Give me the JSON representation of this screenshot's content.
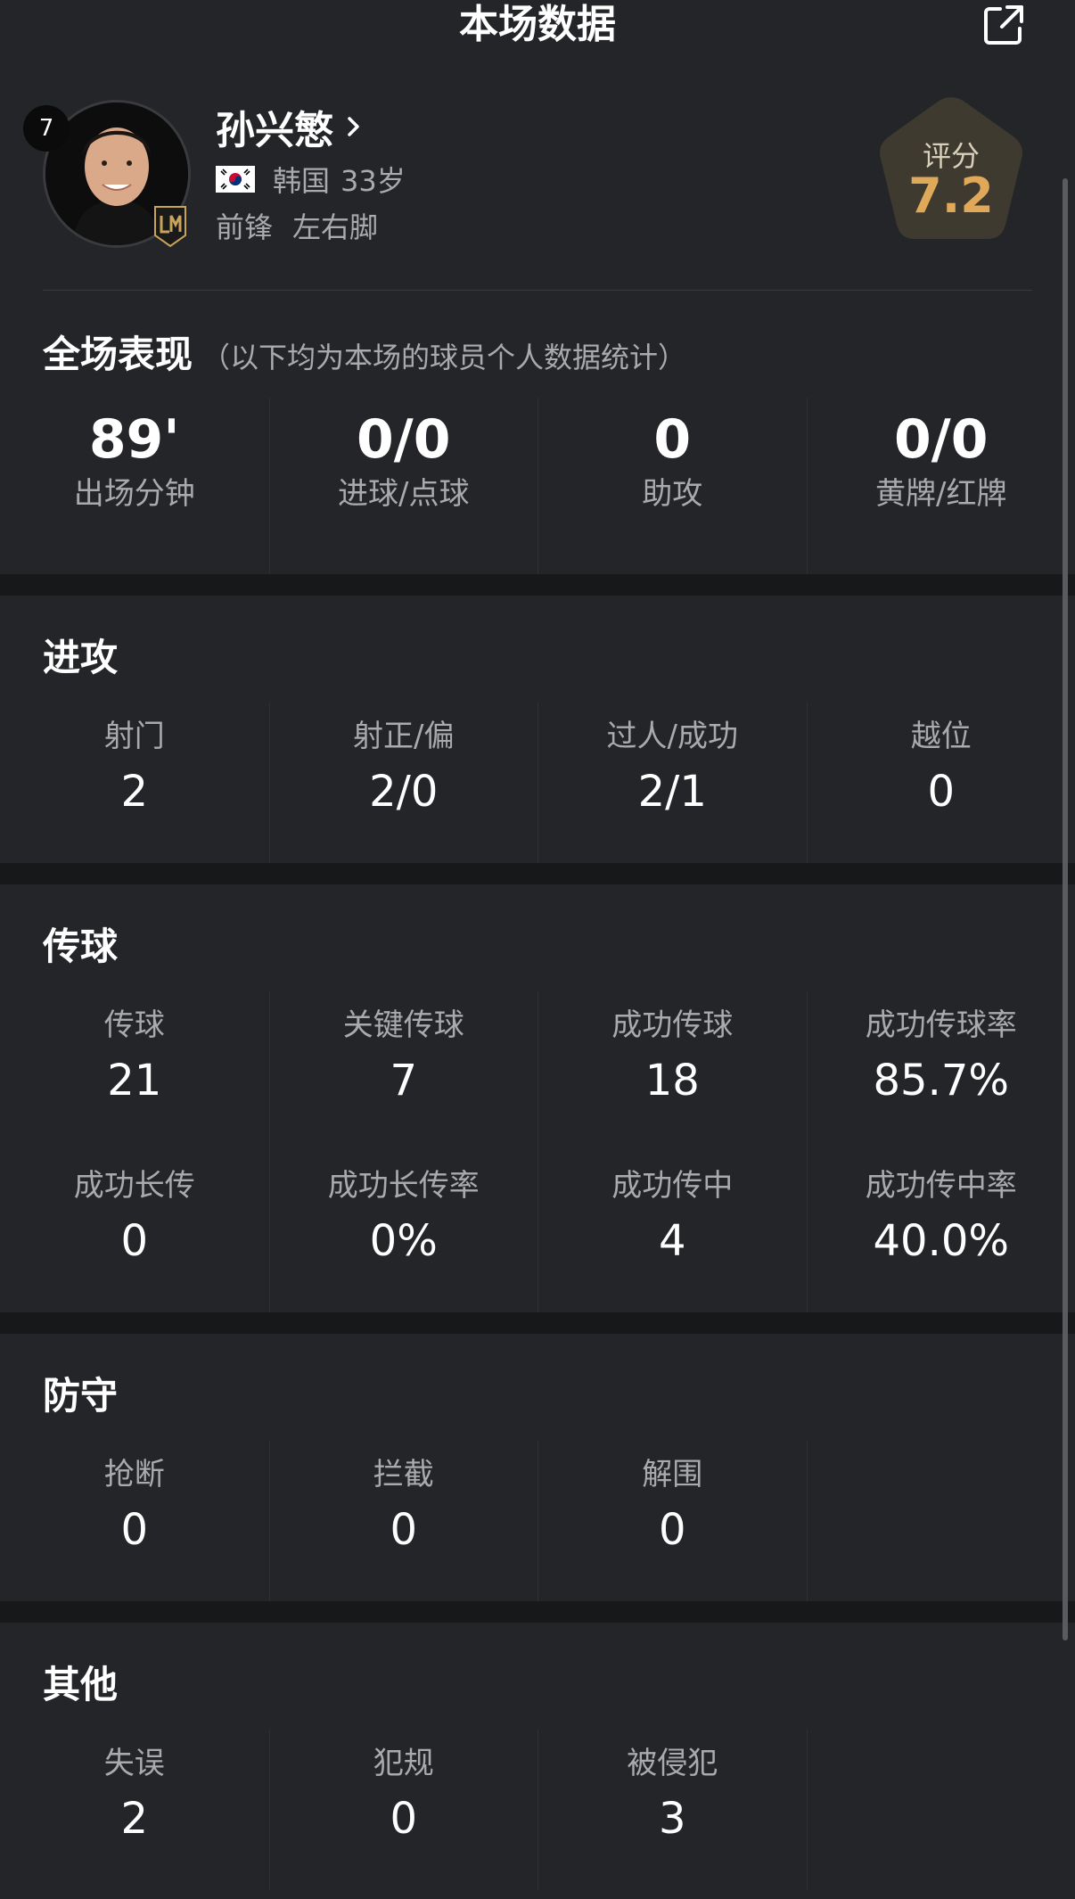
{
  "header": {
    "title": "本场数据",
    "share_icon": "share-icon"
  },
  "player": {
    "number": "7",
    "name": "孙兴慜",
    "flag_icon": "south-korea-flag-icon",
    "country": "韩国",
    "age": "33岁",
    "position": "前锋",
    "foot": "左右脚",
    "rating_label": "评分",
    "rating_value": "7.2",
    "accent_color": "#e0a95a"
  },
  "overall": {
    "title": "全场表现",
    "subtitle": "（以下均为本场的球员个人数据统计）",
    "stats": [
      {
        "value": "89'",
        "label": "出场分钟"
      },
      {
        "value": "0/0",
        "label": "进球/点球"
      },
      {
        "value": "0",
        "label": "助攻"
      },
      {
        "value": "0/0",
        "label": "黄牌/红牌"
      }
    ]
  },
  "attack": {
    "title": "进攻",
    "stats": [
      {
        "label": "射门",
        "value": "2"
      },
      {
        "label": "射正/偏",
        "value": "2/0"
      },
      {
        "label": "过人/成功",
        "value": "2/1"
      },
      {
        "label": "越位",
        "value": "0"
      }
    ]
  },
  "passing": {
    "title": "传球",
    "stats": [
      {
        "label": "传球",
        "value": "21"
      },
      {
        "label": "关键传球",
        "value": "7"
      },
      {
        "label": "成功传球",
        "value": "18"
      },
      {
        "label": "成功传球率",
        "value": "85.7%"
      },
      {
        "label": "成功长传",
        "value": "0"
      },
      {
        "label": "成功长传率",
        "value": "0%"
      },
      {
        "label": "成功传中",
        "value": "4"
      },
      {
        "label": "成功传中率",
        "value": "40.0%"
      }
    ]
  },
  "defense": {
    "title": "防守",
    "stats": [
      {
        "label": "抢断",
        "value": "0"
      },
      {
        "label": "拦截",
        "value": "0"
      },
      {
        "label": "解围",
        "value": "0"
      }
    ]
  },
  "other": {
    "title": "其他",
    "stats": [
      {
        "label": "失误",
        "value": "2"
      },
      {
        "label": "犯规",
        "value": "0"
      },
      {
        "label": "被侵犯",
        "value": "3"
      }
    ]
  }
}
